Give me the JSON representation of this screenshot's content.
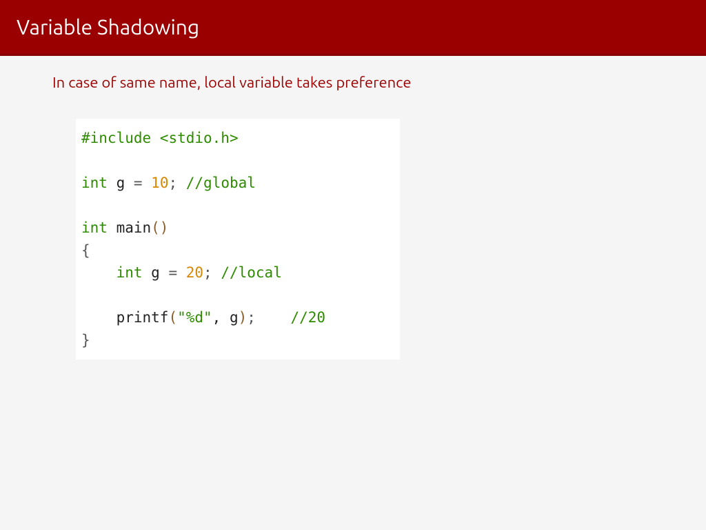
{
  "header": {
    "title": "Variable Shadowing"
  },
  "subtitle": "In case of same name, local variable takes preference",
  "code": {
    "line1_include": "#include",
    "line1_header": " <stdio.h>",
    "line3_int": "int",
    "line3_var": " g ",
    "line3_eq": "= ",
    "line3_val": "10",
    "line3_semi": ";",
    "line3_cmt": " //global",
    "line5_int": "int",
    "line5_main": " main",
    "line5_parens": "()",
    "line6_brace": "{",
    "line7_indent": "    ",
    "line7_int": "int",
    "line7_var": " g ",
    "line7_eq": "= ",
    "line7_val": "20",
    "line7_semi": ";",
    "line7_cmt": " //local",
    "line9_indent": "    ",
    "line9_printf": "printf",
    "line9_open": "(",
    "line9_str": "\"%d\"",
    "line9_comma": ", g",
    "line9_close": ")",
    "line9_semi": ";",
    "line9_space": "    ",
    "line9_cmt": "//20",
    "line10_brace": "}"
  }
}
